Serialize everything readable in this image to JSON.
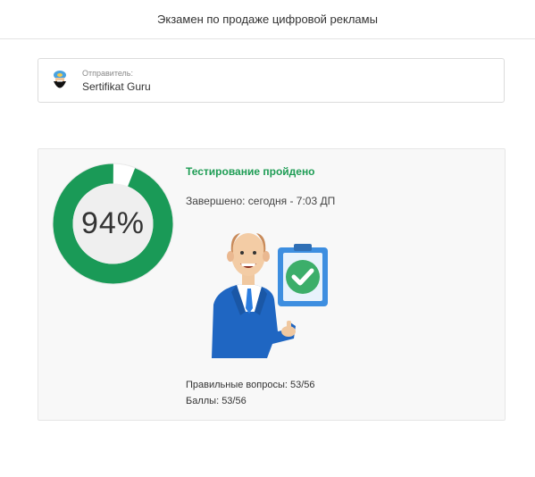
{
  "header": {
    "title": "Экзамен по продаже цифровой рекламы"
  },
  "sender": {
    "label": "Отправитель:",
    "name": "Sertifikat Guru",
    "avatar_icon": "bearded-man-avatar-icon"
  },
  "result": {
    "score_percent": 94,
    "score_text": "94%",
    "status": "Тестирование пройдено",
    "completed": "Завершено: сегодня - 7:03 ДП",
    "correct_questions": "Правильные вопросы: 53/56",
    "points": "Баллы: 53/56",
    "illustration_icon": "businessman-thumbs-up-checklist-icon"
  },
  "colors": {
    "accent_green": "#1f9d55",
    "ring_green": "#1a9a57",
    "ring_remainder": "#ffffff",
    "card_bg": "#f8f8f8"
  }
}
